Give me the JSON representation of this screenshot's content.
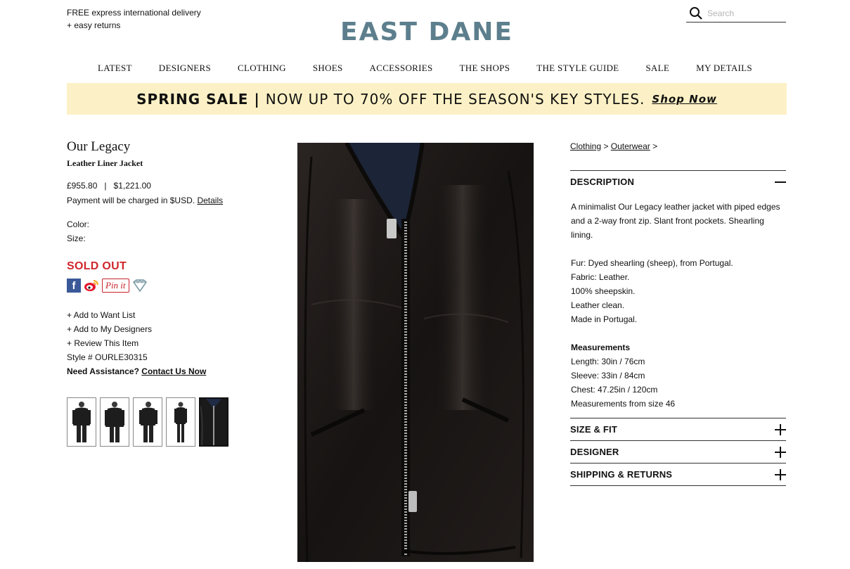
{
  "header": {
    "promo_line1": "FREE express international delivery",
    "promo_line2": "+ easy returns",
    "logo": "EAST DANE",
    "search_placeholder": "Search"
  },
  "nav": [
    "LATEST",
    "DESIGNERS",
    "CLOTHING",
    "SHOES",
    "ACCESSORIES",
    "THE SHOPS",
    "THE STYLE GUIDE",
    "SALE",
    "MY DETAILS"
  ],
  "banner": {
    "bold": "SPRING SALE",
    "divider": "|",
    "text": "NOW UP TO 70% OFF THE SEASON'S KEY STYLES.",
    "cta": "Shop Now",
    "bg_color": "#fcf1c6"
  },
  "product": {
    "brand": "Our Legacy",
    "name": "Leather Liner Jacket",
    "price_gbp": "£955.80",
    "price_sep": "|",
    "price_usd": "$1,221.00",
    "payment_text": "Payment will be charged in $USD.",
    "payment_link": "Details",
    "color_label": "Color:",
    "size_label": "Size:",
    "status": "SOLD OUT",
    "status_color": "#d0262b",
    "social": [
      "facebook-icon",
      "weibo-icon",
      "pinterest-icon",
      "heart-icon"
    ],
    "pinterest_label": "Pin it",
    "facebook_label": "f",
    "links": [
      "+ Add to Want List",
      "+ Add to My Designers",
      "+ Review This Item"
    ],
    "style_no": "Style # OURLE30315",
    "assist_label": "Need Assistance?",
    "assist_link": "Contact Us Now",
    "thumbnail_count": 5
  },
  "details": {
    "breadcrumb": [
      "Clothing",
      "Outerwear"
    ],
    "breadcrumb_sep": ">",
    "description_title": "DESCRIPTION",
    "description": "A minimalist Our Legacy leather jacket with piped edges and a 2-way front zip. Slant front pockets. Shearling lining.",
    "materials": [
      "Fur: Dyed shearling (sheep), from Portugal.",
      "Fabric: Leather.",
      "100% sheepskin.",
      "Leather clean.",
      "Made in Portugal."
    ],
    "measurements_title": "Measurements",
    "measurements": [
      "Length: 30in / 76cm",
      "Sleeve: 33in / 84cm",
      "Chest: 47.25in / 120cm",
      "Measurements from size 46"
    ],
    "sections": [
      "SIZE & FIT",
      "DESIGNER",
      "SHIPPING & RETURNS"
    ]
  }
}
